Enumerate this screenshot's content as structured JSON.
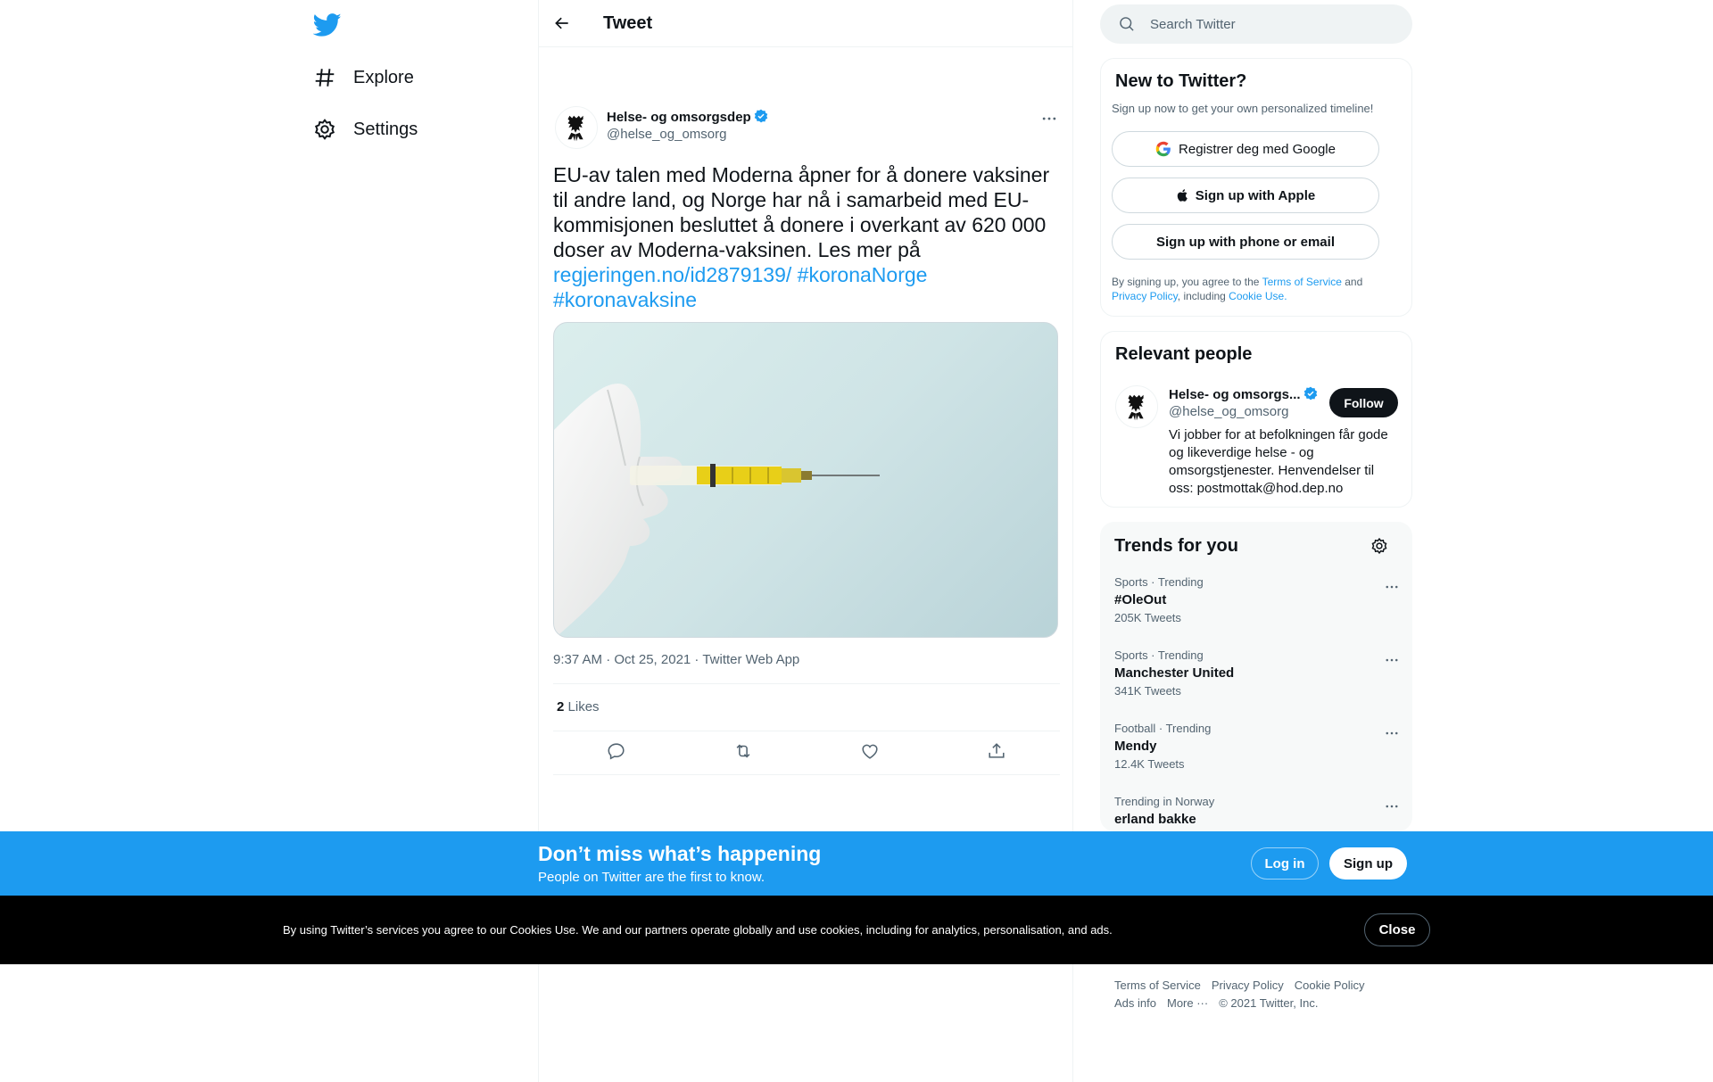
{
  "colors": {
    "accent": "#1d9bf0",
    "text": "#0f1419",
    "muted": "#536471",
    "border": "#eff3f4"
  },
  "nav": {
    "logo_icon": "twitter-bird-icon",
    "items": [
      {
        "label": "Explore",
        "icon": "hashtag-icon"
      },
      {
        "label": "Settings",
        "icon": "gear-icon"
      }
    ]
  },
  "header": {
    "title": "Tweet",
    "back_icon": "arrow-left-icon"
  },
  "tweet": {
    "author_name": "Helse- og omsorgsdep",
    "author_handle": "@helse_og_omsorg",
    "text": "EU-av talen med Moderna åpner for å donere vaksiner til andre land, og Norge har nå i samarbeid med EU-kommisjonen besluttet å donere i overkant av 620 000 doser av Moderna-vaksinen. Les mer på ",
    "link": "regjeringen.no/id2879139/",
    "hashtag1": "#koronaNorge",
    "hashtag2": "#koronavaksine",
    "timestamp": "9:37 AM · Oct 25, 2021 · Twitter Web App",
    "likes_count": "2",
    "likes_label": "Likes"
  },
  "search": {
    "placeholder": "Search Twitter"
  },
  "signup_card": {
    "title": "New to Twitter?",
    "subtitle": "Sign up now to get your own personalized timeline!",
    "google_label": "Registrer deg med Google",
    "apple_label": "Sign up with Apple",
    "phone_label": "Sign up with phone or email",
    "legal_prefix": "By signing up, you agree to the ",
    "terms": "Terms of Service",
    "and": " and ",
    "privacy": "Privacy Policy",
    "including": ", including ",
    "cookie": "Cookie Use."
  },
  "relevant_people": {
    "title": "Relevant people",
    "name": "Helse- og omsorgs...",
    "handle": "@helse_og_omsorg",
    "follow_label": "Follow",
    "bio": "Vi jobber for at befolkningen får gode og likeverdige helse - og omsorgstjenester. Henvendelser til oss: postmottak@hod.dep.no"
  },
  "trends": {
    "title": "Trends for you",
    "items": [
      {
        "meta": "Sports · Trending",
        "name": "#OleOut",
        "count": "205K Tweets"
      },
      {
        "meta": "Sports · Trending",
        "name": "Manchester United",
        "count": "341K Tweets"
      },
      {
        "meta": "Football · Trending",
        "name": "Mendy",
        "count": "12.4K Tweets"
      },
      {
        "meta": "Trending in Norway",
        "name": "erland bakke",
        "count": ""
      }
    ]
  },
  "footer": {
    "terms": "Terms of Service",
    "privacy": "Privacy Policy",
    "cookie": "Cookie Policy",
    "ads": "Ads info",
    "more": "More ···",
    "copyright": "© 2021 Twitter, Inc."
  },
  "bottom_bar": {
    "title": "Don’t miss what’s happening",
    "subtitle": "People on Twitter are the first to know.",
    "login_label": "Log in",
    "signup_label": "Sign up"
  },
  "cookie_bar": {
    "text": "By using Twitter’s services you agree to our Cookies Use. We and our partners operate globally and use cookies, including for analytics, personalisation, and ads.",
    "close_label": "Close"
  }
}
